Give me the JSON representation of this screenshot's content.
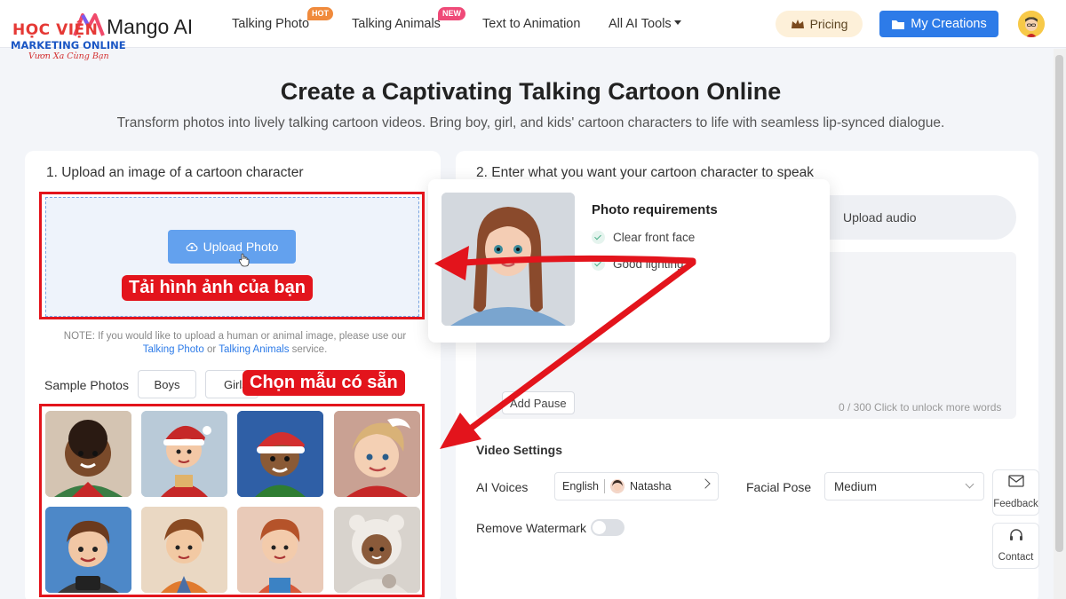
{
  "watermark_logo": {
    "line1": "HỌC VIỆN",
    "line2": "MARKETING ONLINE",
    "line3": "Vươn Xa Cùng Bạn"
  },
  "header": {
    "brand": "Mango AI",
    "nav": [
      {
        "label": "Talking Photo",
        "badge": "HOT"
      },
      {
        "label": "Talking Animals",
        "badge": "NEW"
      },
      {
        "label": "Text to Animation"
      },
      {
        "label": "All AI Tools"
      }
    ],
    "pricing": "Pricing",
    "my_creations": "My Creations"
  },
  "hero": {
    "title": "Create a Captivating Talking Cartoon Online",
    "subtitle": "Transform photos into lively talking cartoon videos. Bring boy, girl, and kids' cartoon characters to life with seamless lip-synced dialogue."
  },
  "step1": {
    "label": "1.  Upload an image of a cartoon character",
    "upload_button": "Upload Photo",
    "note_prefix": "NOTE: If you would like to upload a human or animal image, please use our",
    "note_link1": "Talking Photo",
    "note_or": "or",
    "note_link2": "Talking Animals",
    "note_suffix": "service.",
    "sample_label": "Sample Photos",
    "tab_boys": "Boys",
    "tab_girls": "Girls"
  },
  "step2": {
    "label": "2.  Enter what you want your cartoon character to speak",
    "upload_audio": "Upload audio",
    "add_pause": "Add Pause",
    "count": "0 / 300  Click to unlock more words",
    "video_settings": "Video Settings",
    "ai_voices": "AI Voices",
    "voice_lang": "English",
    "voice_name": "Natasha",
    "facial_pose": "Facial Pose",
    "facial_value": "Medium",
    "remove_watermark": "Remove Watermark"
  },
  "side": {
    "feedback": "Feedback",
    "contact": "Contact"
  },
  "popover": {
    "title": "Photo requirements",
    "req1": "Clear front face",
    "req2": "Good lighting"
  },
  "annotations": {
    "upload": "Tải hình ảnh của bạn",
    "samples": "Chọn mẫu có sẵn"
  },
  "colors": {
    "accent": "#2d7be8",
    "annotation": "#e3141c",
    "upload_btn": "#63a1ee"
  }
}
